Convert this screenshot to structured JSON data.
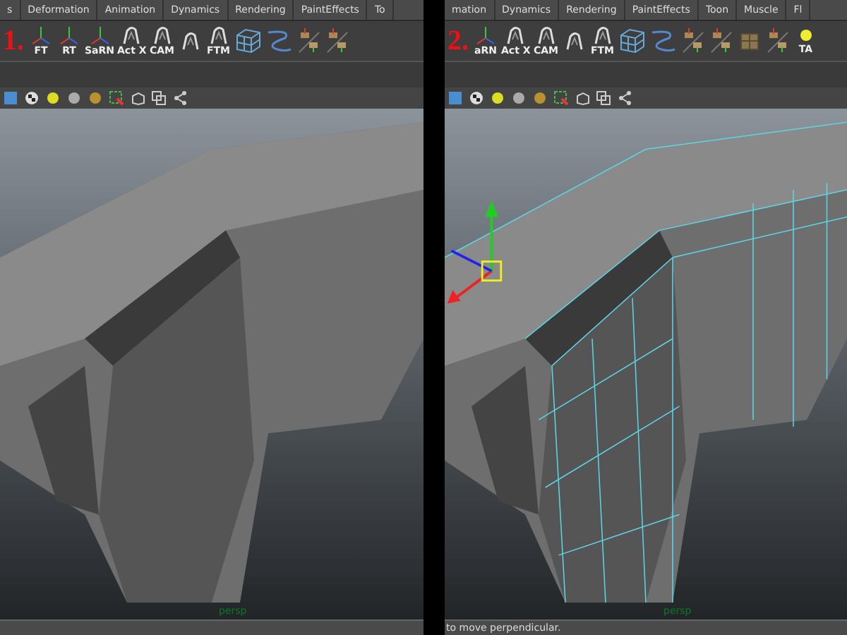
{
  "panels": [
    {
      "number": "1.",
      "wireframe": false,
      "menu_tabs": [
        "s",
        "Deformation",
        "Animation",
        "Dynamics",
        "Rendering",
        "PaintEffects",
        "To"
      ],
      "shelf": [
        {
          "kind": "axis",
          "label": "FT"
        },
        {
          "kind": "axis",
          "label": "RT"
        },
        {
          "kind": "axis",
          "label": "SaRN"
        },
        {
          "kind": "script",
          "label": "Act X"
        },
        {
          "kind": "script",
          "label": "CAM"
        },
        {
          "kind": "script"
        },
        {
          "kind": "script",
          "label": "FTM"
        },
        {
          "kind": "cage"
        },
        {
          "kind": "curve"
        },
        {
          "kind": "tool"
        },
        {
          "kind": "tool"
        }
      ],
      "viewport_label": "persp"
    },
    {
      "number": "2.",
      "wireframe": true,
      "menu_tabs": [
        "mation",
        "Dynamics",
        "Rendering",
        "PaintEffects",
        "Toon",
        "Muscle",
        "Fl"
      ],
      "shelf": [
        {
          "kind": "axis",
          "label": "aRN"
        },
        {
          "kind": "script",
          "label": "Act X"
        },
        {
          "kind": "script",
          "label": "CAM"
        },
        {
          "kind": "script"
        },
        {
          "kind": "script",
          "label": "FTM"
        },
        {
          "kind": "cage"
        },
        {
          "kind": "curve"
        },
        {
          "kind": "tool"
        },
        {
          "kind": "tool"
        },
        {
          "kind": "box"
        },
        {
          "kind": "tool"
        },
        {
          "kind": "light",
          "label": "TA"
        }
      ],
      "viewport_label": "persp",
      "status_text": "to move perpendicular."
    }
  ]
}
